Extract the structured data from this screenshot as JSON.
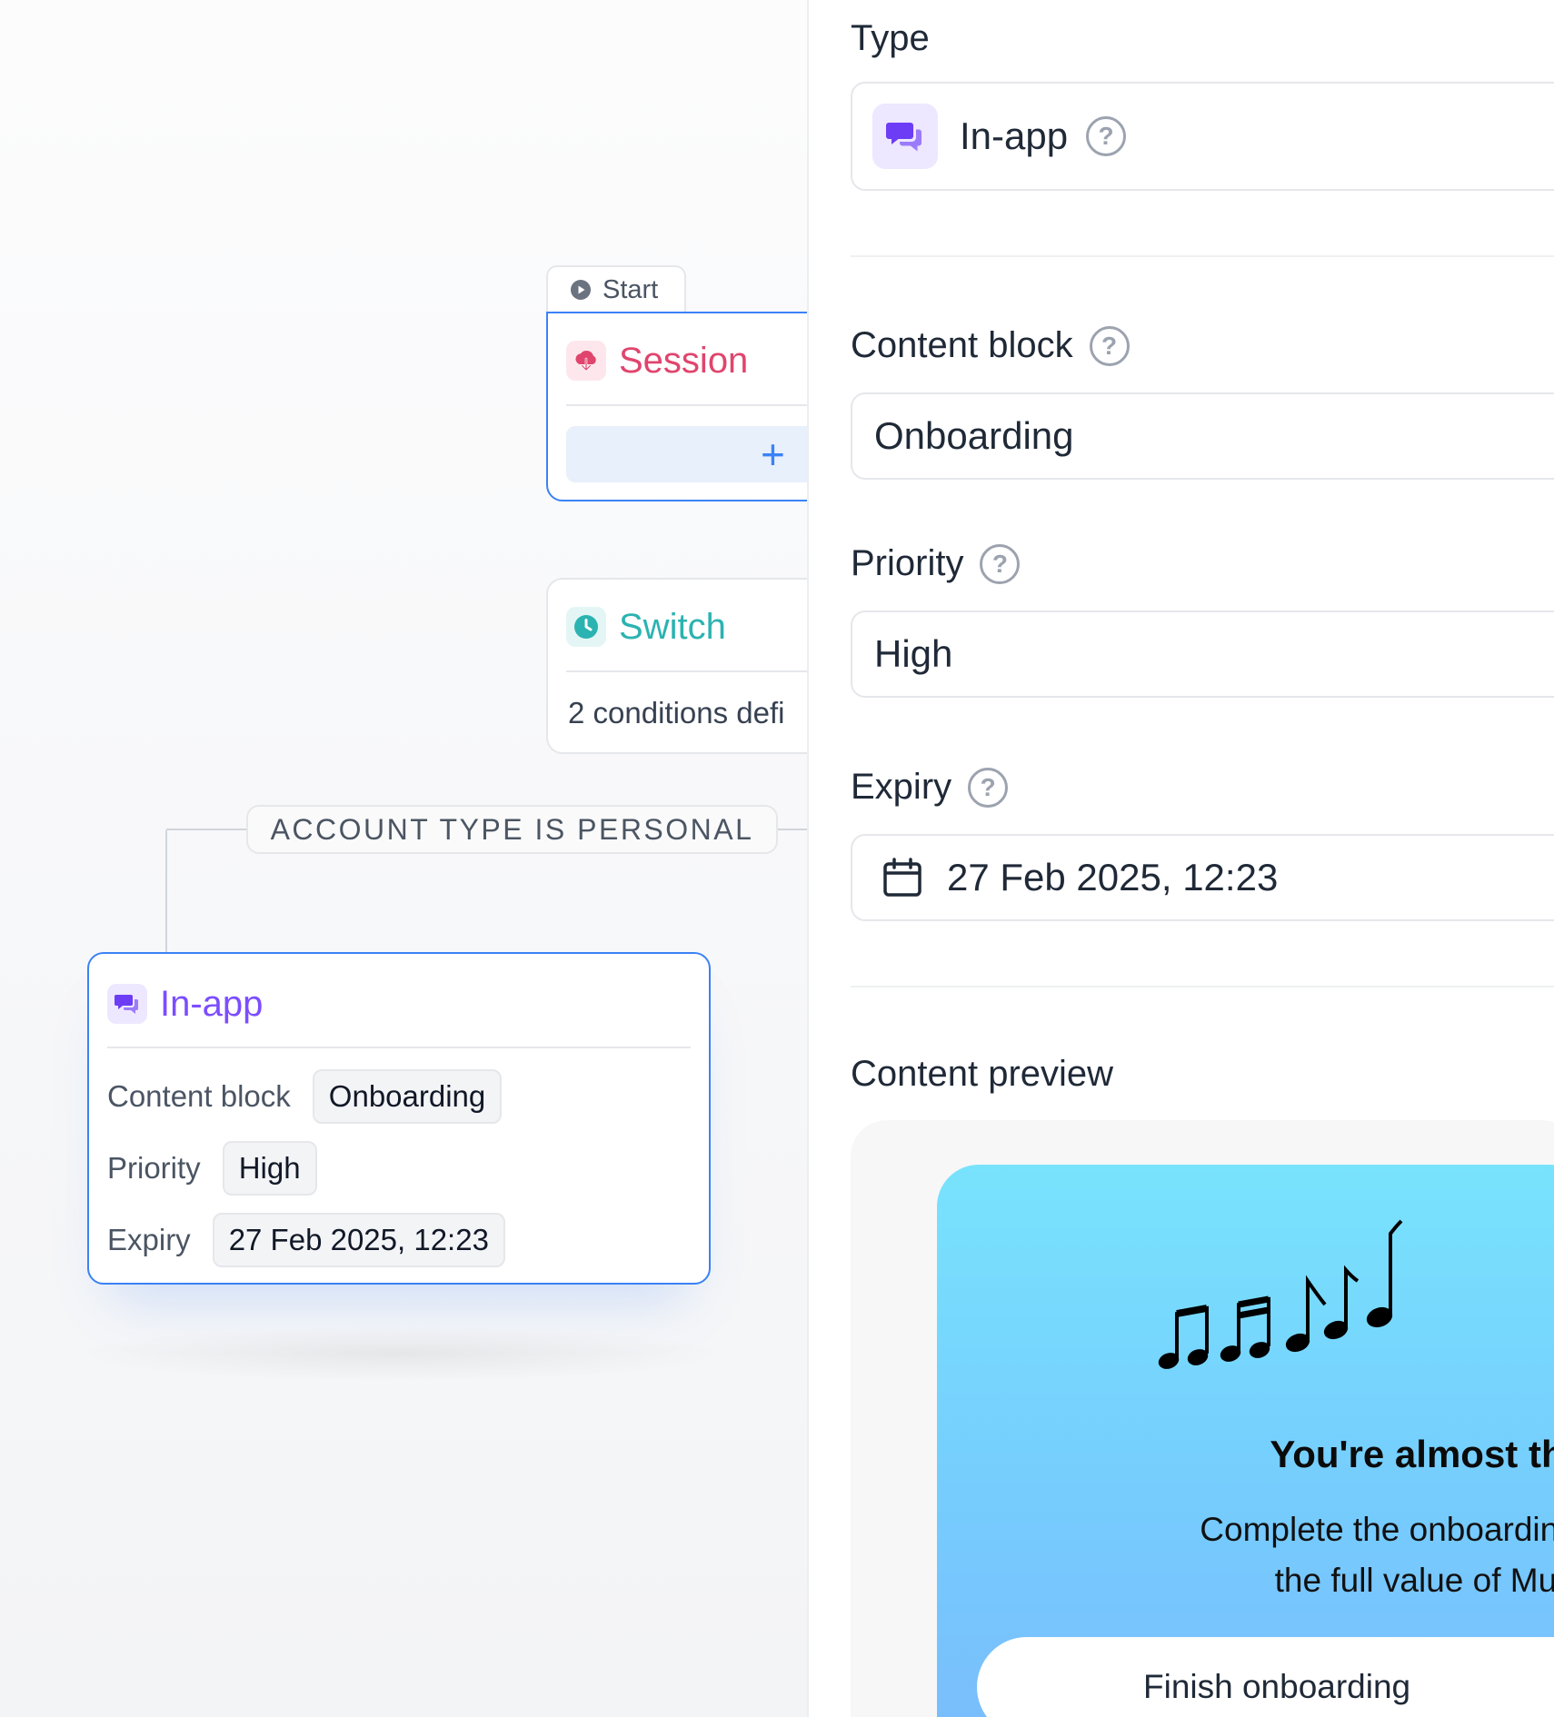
{
  "canvas": {
    "start_tab": {
      "label": "Start"
    },
    "session_node": {
      "title": "Session",
      "add_label": "+"
    },
    "switch_node": {
      "title": "Switch",
      "description": "2 conditions defi"
    },
    "branch": {
      "label": "ACCOUNT TYPE IS PERSONAL"
    },
    "inapp_node": {
      "title": "In-app",
      "rows": [
        {
          "label": "Content block",
          "value": "Onboarding"
        },
        {
          "label": "Priority",
          "value": "High"
        },
        {
          "label": "Expiry",
          "value": "27 Feb 2025, 12:23"
        }
      ]
    }
  },
  "panel": {
    "type": {
      "label": "Type",
      "value": "In-app"
    },
    "content_block": {
      "label": "Content block",
      "value": "Onboarding"
    },
    "priority": {
      "label": "Priority",
      "value": "High"
    },
    "expiry": {
      "label": "Expiry",
      "value": "27 Feb 2025, 12:23"
    },
    "preview": {
      "label": "Content preview",
      "title": "You're almost there!",
      "body_line1": "Complete the onboarding to unloc",
      "body_line2": "the full value of MusicX.",
      "button": "Finish onboarding"
    }
  },
  "colors": {
    "accent_blue": "#3b82f6",
    "session_red": "#e0456d",
    "switch_teal": "#2bb3b1",
    "inapp_purple": "#7c4dff"
  },
  "icons": {
    "start": "play-circle-icon",
    "session": "cloud-download-icon",
    "switch": "clock-icon",
    "inapp": "chat-bubbles-icon",
    "help": "help-circle-icon",
    "calendar": "calendar-icon",
    "preview_art": "music-notes-icon"
  }
}
